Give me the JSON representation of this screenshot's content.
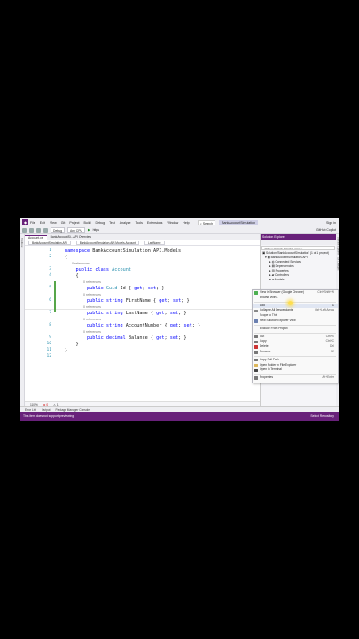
{
  "window": {
    "menu": [
      "File",
      "Edit",
      "View",
      "Git",
      "Project",
      "Build",
      "Debug",
      "Test",
      "Analyze",
      "Tools",
      "Extensions",
      "Window",
      "Help"
    ],
    "search_label": "Search",
    "solution_name": "BankAccountSimulation",
    "sign_in": "Sign in",
    "copilot": "GitHub Copilot"
  },
  "toolbar": {
    "config": "Debug",
    "platform": "Any CPU",
    "run_label": "https"
  },
  "left_strip": {
    "label": "Toolbox"
  },
  "tabs": [
    {
      "label": "Account.cs"
    },
    {
      "label": "BankAccountSi...API Overview"
    }
  ],
  "nav_bar": {
    "project": "BankAccountSimulation.API",
    "namespace": "BankAccountSimulation.API.Models.Account",
    "member": "LastName"
  },
  "code": {
    "lines": [
      {
        "num": "1",
        "tokens": [
          {
            "t": "namespace ",
            "c": "kw"
          },
          {
            "t": "BankAccountSimulation.API.Models",
            "c": ""
          }
        ]
      },
      {
        "num": "2",
        "tokens": [
          {
            "t": "{",
            "c": ""
          }
        ]
      },
      {
        "num": "3",
        "tokens": [
          {
            "t": "    ",
            "c": ""
          },
          {
            "t": "public ",
            "c": "kw"
          },
          {
            "t": "class ",
            "c": "kw"
          },
          {
            "t": "Account",
            "c": "ty"
          }
        ]
      },
      {
        "num": "4",
        "tokens": [
          {
            "t": "    {",
            "c": ""
          }
        ]
      },
      {
        "num": "5",
        "tokens": [
          {
            "t": "        ",
            "c": ""
          },
          {
            "t": "public ",
            "c": "kw"
          },
          {
            "t": "Guid ",
            "c": "ty"
          },
          {
            "t": "Id { ",
            "c": ""
          },
          {
            "t": "get",
            "c": "kw"
          },
          {
            "t": "; ",
            "c": ""
          },
          {
            "t": "set",
            "c": "kw"
          },
          {
            "t": "; }",
            "c": ""
          }
        ]
      },
      {
        "num": "6",
        "tokens": [
          {
            "t": "        ",
            "c": ""
          },
          {
            "t": "public ",
            "c": "kw"
          },
          {
            "t": "string ",
            "c": "kw"
          },
          {
            "t": "FirstName { ",
            "c": ""
          },
          {
            "t": "get",
            "c": "kw"
          },
          {
            "t": "; ",
            "c": ""
          },
          {
            "t": "set",
            "c": "kw"
          },
          {
            "t": "; }",
            "c": ""
          }
        ]
      },
      {
        "num": "7",
        "tokens": [
          {
            "t": "        ",
            "c": ""
          },
          {
            "t": "public ",
            "c": "kw"
          },
          {
            "t": "string ",
            "c": "kw"
          },
          {
            "t": "LastName { ",
            "c": ""
          },
          {
            "t": "get",
            "c": "kw"
          },
          {
            "t": "; ",
            "c": ""
          },
          {
            "t": "set",
            "c": "kw"
          },
          {
            "t": "; }",
            "c": ""
          }
        ]
      },
      {
        "num": "8",
        "tokens": [
          {
            "t": "        ",
            "c": ""
          },
          {
            "t": "public ",
            "c": "kw"
          },
          {
            "t": "string ",
            "c": "kw"
          },
          {
            "t": "AccountNumber { ",
            "c": ""
          },
          {
            "t": "get",
            "c": "kw"
          },
          {
            "t": "; ",
            "c": ""
          },
          {
            "t": "set",
            "c": "kw"
          },
          {
            "t": "; }",
            "c": ""
          }
        ]
      },
      {
        "num": "9",
        "tokens": [
          {
            "t": "        ",
            "c": ""
          },
          {
            "t": "public ",
            "c": "kw"
          },
          {
            "t": "decimal ",
            "c": "kw"
          },
          {
            "t": "Balance { ",
            "c": ""
          },
          {
            "t": "get",
            "c": "kw"
          },
          {
            "t": "; ",
            "c": ""
          },
          {
            "t": "set",
            "c": "kw"
          },
          {
            "t": "; }",
            "c": ""
          }
        ]
      },
      {
        "num": "10",
        "tokens": [
          {
            "t": "    }",
            "c": ""
          }
        ]
      },
      {
        "num": "11",
        "tokens": [
          {
            "t": "}",
            "c": ""
          }
        ]
      },
      {
        "num": "12",
        "tokens": []
      }
    ],
    "ref_label": "0 references"
  },
  "editor_status": {
    "zoom": "110 %",
    "errors": "0",
    "warnings": "1"
  },
  "panel_tabs": [
    "Error List",
    "Output",
    "Package Manager Console"
  ],
  "statusbar": {
    "left": "This item does not support previewing",
    "right": "Select Repository"
  },
  "solution_explorer": {
    "title": "Solution Explorer",
    "search_placeholder": "Search Solution Explorer (Ctrl+;)",
    "nodes": [
      "Solution 'BankAccountSimulation' (1 of 1 project)",
      "BankAccountSimulation.API",
      "Connected Services",
      "Dependencies",
      "Properties",
      "Controllers",
      "Models"
    ]
  },
  "right_strip": {
    "label1": "Solution Explorer",
    "label2": "Git Changes"
  },
  "context_menu": {
    "items": [
      {
        "label": "View in Browser (Google Chrome)",
        "shortcut": "Ctrl+Shift+W",
        "icon": "browser-icon",
        "color": "#4caf50"
      },
      {
        "label": "Browse With...",
        "shortcut": "",
        "icon": "",
        "color": ""
      },
      {
        "sep": true
      },
      {
        "label": "Add",
        "shortcut": "▸",
        "icon": "",
        "color": "",
        "hover": true
      },
      {
        "label": "Collapse All Descendants",
        "shortcut": "Ctrl+Left Arrow",
        "icon": "collapse-icon",
        "color": "#888"
      },
      {
        "label": "Scope to This",
        "shortcut": "",
        "icon": "",
        "color": ""
      },
      {
        "label": "New Solution Explorer View",
        "shortcut": "",
        "icon": "window-icon",
        "color": "#6a7fb0"
      },
      {
        "sep": true
      },
      {
        "label": "Exclude From Project",
        "shortcut": "",
        "icon": "",
        "color": ""
      },
      {
        "sep": true
      },
      {
        "label": "Cut",
        "shortcut": "Ctrl+X",
        "icon": "cut-icon",
        "color": "#777"
      },
      {
        "label": "Copy",
        "shortcut": "Ctrl+C",
        "icon": "copy-icon",
        "color": "#777"
      },
      {
        "label": "Delete",
        "shortcut": "Del",
        "icon": "delete-icon",
        "color": "#c33"
      },
      {
        "label": "Rename",
        "shortcut": "F2",
        "icon": "rename-icon",
        "color": "#777"
      },
      {
        "sep": true
      },
      {
        "label": "Copy Full Path",
        "shortcut": "",
        "icon": "copy-path-icon",
        "color": "#777"
      },
      {
        "label": "Open Folder in File Explorer",
        "shortcut": "",
        "icon": "folder-icon",
        "color": "#dcb65a"
      },
      {
        "label": "Open in Terminal",
        "shortcut": "",
        "icon": "terminal-icon",
        "color": "#444"
      },
      {
        "sep": true
      },
      {
        "label": "Properties",
        "shortcut": "Alt+Enter",
        "icon": "wrench-icon",
        "color": "#777"
      }
    ]
  }
}
